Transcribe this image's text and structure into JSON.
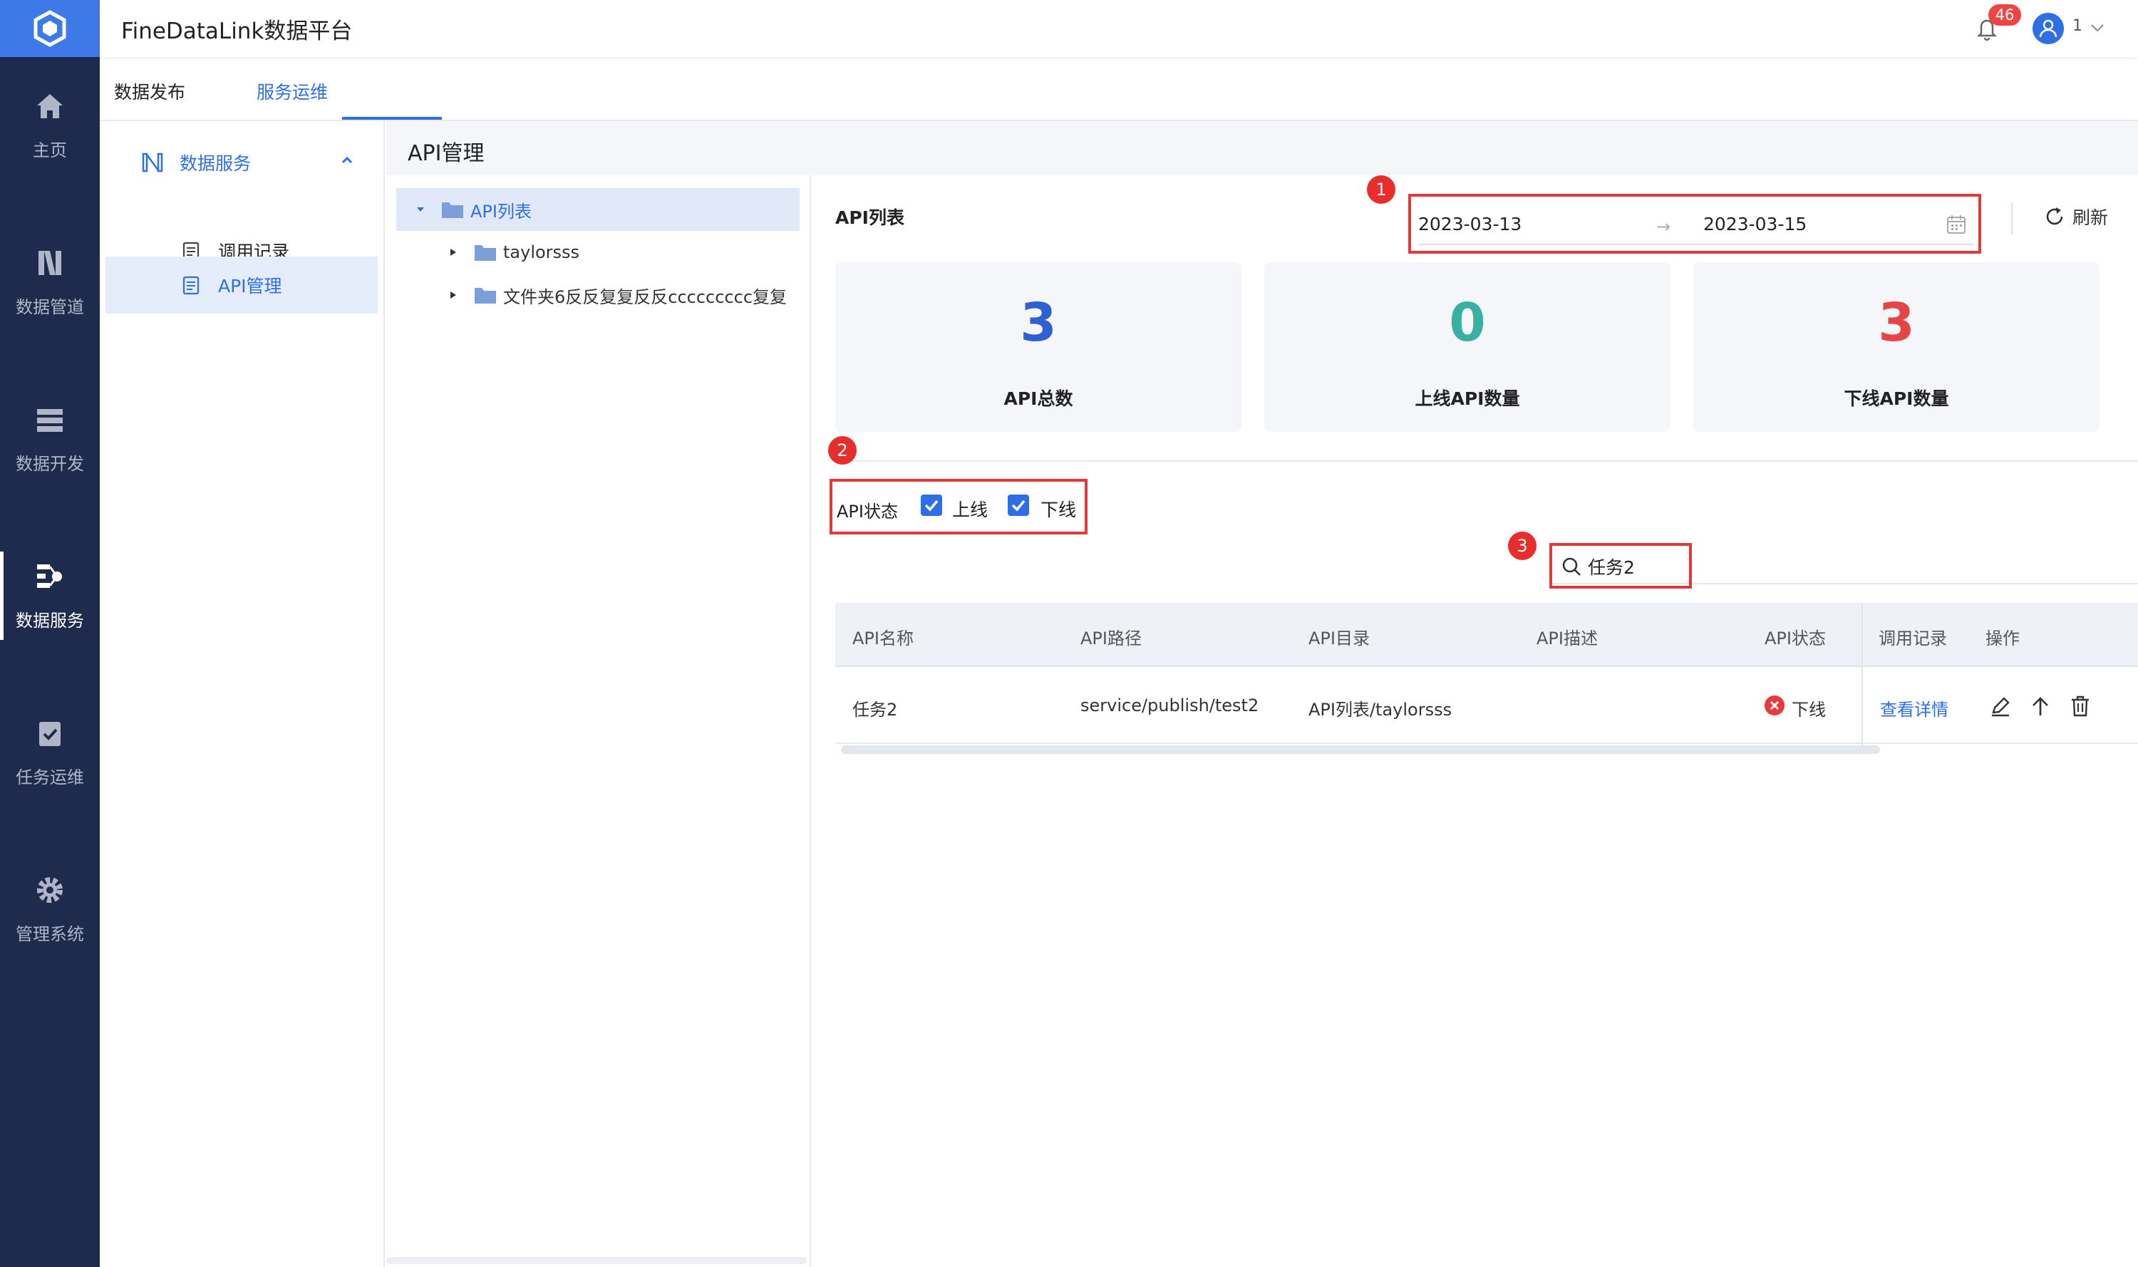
{
  "app": {
    "title": "FineDataLink数据平台",
    "notifications": "46",
    "user": "1"
  },
  "colors": {
    "accent": "#2f6fe6",
    "nav_bg": "#1e2b4d",
    "online": "#3ab0a2",
    "offline": "#e64545",
    "annotation": "#e03a3a"
  },
  "nav": [
    {
      "label": "主页",
      "icon": "home-icon"
    },
    {
      "label": "数据管道",
      "icon": "pipeline-icon"
    },
    {
      "label": "数据开发",
      "icon": "dev-icon"
    },
    {
      "label": "数据服务",
      "icon": "service-icon",
      "active": true
    },
    {
      "label": "任务运维",
      "icon": "clipboard-check-icon"
    },
    {
      "label": "管理系统",
      "icon": "gear-icon"
    }
  ],
  "tabs": [
    {
      "label": "数据发布"
    },
    {
      "label": "服务运维",
      "active": true
    }
  ],
  "sidebar": {
    "group": "数据服务",
    "items": [
      {
        "label": "调用记录"
      },
      {
        "label": "API管理",
        "active": true
      }
    ]
  },
  "content": {
    "title": "API管理"
  },
  "tree": {
    "root": "API列表",
    "children": [
      "taylorsss",
      "文件夹6反反复复反反ccccccccc复复"
    ]
  },
  "list": {
    "title": "API列表",
    "date_start": "2023-03-13",
    "date_arrow": "→",
    "date_end": "2023-03-15",
    "refresh": "刷新"
  },
  "stats": [
    {
      "value": "3",
      "label": "API总数",
      "color": "#2f5fd0"
    },
    {
      "value": "0",
      "label": "上线API数量",
      "color": "#3ab0a2"
    },
    {
      "value": "3",
      "label": "下线API数量",
      "color": "#e64545"
    }
  ],
  "filter": {
    "label": "API状态",
    "online": "上线",
    "offline": "下线"
  },
  "search": {
    "value": "任务2",
    "placeholder": ""
  },
  "markers": [
    "1",
    "2",
    "3"
  ],
  "table": {
    "columns": [
      "API名称",
      "API路径",
      "API目录",
      "API描述",
      "API状态",
      "调用记录",
      "操作"
    ],
    "rows": [
      {
        "name": "任务2",
        "path": "service/publish/test2",
        "dir": "API列表/taylorsss",
        "desc": "",
        "status": "下线",
        "record": "查看详情"
      }
    ]
  }
}
